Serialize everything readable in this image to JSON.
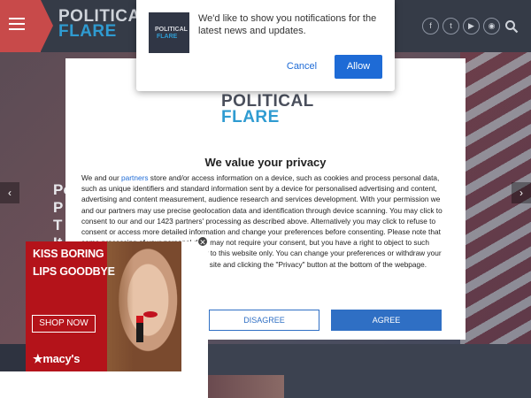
{
  "header": {
    "logo_line1": "POLITICAL",
    "logo_line2": "FLARE",
    "social_icons": [
      "facebook-icon",
      "twitter-icon",
      "youtube-icon",
      "rss-icon"
    ],
    "social_glyphs": [
      "f",
      "t",
      "▶",
      "◉"
    ],
    "search_icon": "search-icon",
    "menu_icon": "hamburger-icon"
  },
  "hero": {
    "title_fragment": "Po P T It"
  },
  "notification": {
    "icon_line1": "POLITICAL",
    "icon_line2": "FLARE",
    "message": "We'd like to show you notifications for the latest news and updates.",
    "cancel_label": "Cancel",
    "allow_label": "Allow"
  },
  "consent": {
    "logo_line1": "POLITICAL",
    "logo_line2": "FLARE",
    "heading": "We value your privacy",
    "body_part1": "We and our ",
    "body_link": "partners",
    "body_part2": " store and/or access information on a device, such as cookies and process personal data, such as unique identifiers and standard information sent by a device for personalised advertising and content, advertising and content measurement, audience research and services development. With your permission we and our partners may use precise geolocation data and identification through device scanning. You may click to consent to our and our 1423 partners' processing as described above. Alternatively you may click to refuse to consent or access more detailed information and change your preferences before consenting. Please note that some processing of your personal data may not require your consent, but you have a right to object to such processing. Your preferences will apply to this website only. You can change your preferences or withdraw your consent at any time by returning to this site and clicking the \"Privacy\" button at the bottom of the webpage.",
    "disagree_label": "DISAGREE",
    "agree_label": "AGREE"
  },
  "ad": {
    "headline1": "KISS BORING",
    "headline2": "LIPS GOODBYE",
    "cta": "SHOP NOW",
    "brand": "★macy's",
    "close": "✕"
  },
  "colors": {
    "brand_blue": "#2f9bd1",
    "menu_red": "#c84a4a",
    "button_blue": "#2f6fc4",
    "ad_red": "#b4131a"
  }
}
